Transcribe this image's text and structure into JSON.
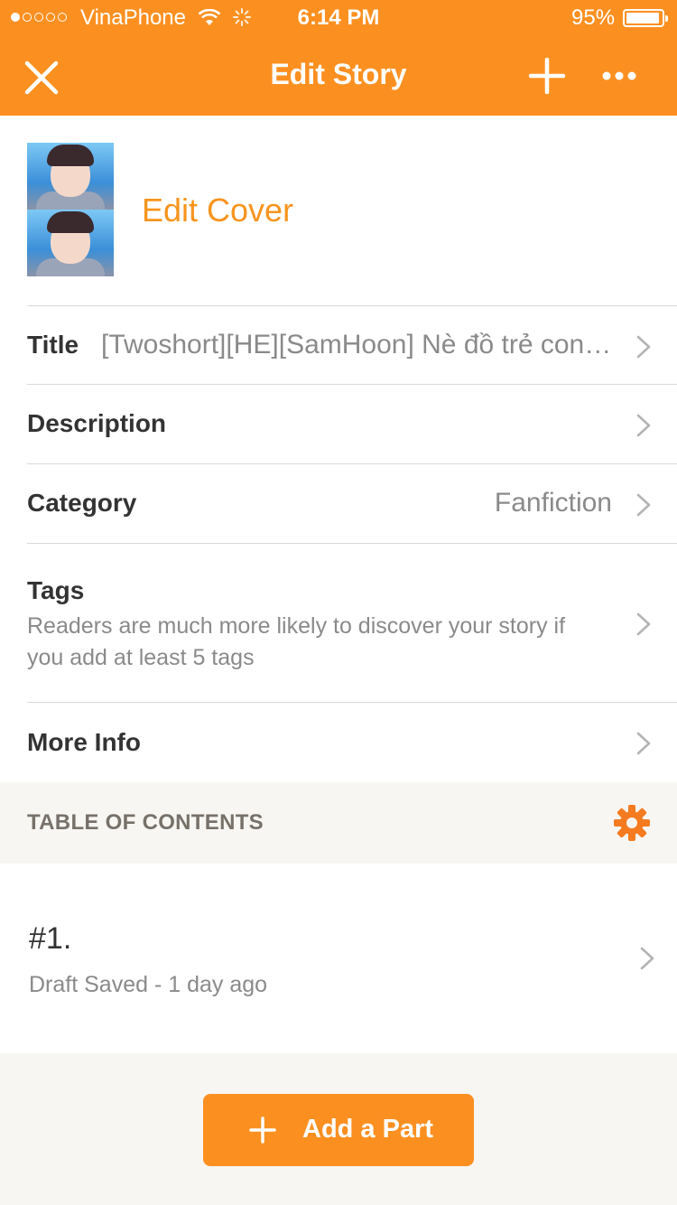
{
  "status_bar": {
    "carrier": "VinaPhone",
    "time": "6:14 PM",
    "battery_percent": "95%",
    "battery_level": 0.95,
    "signal_bars_filled": 1,
    "signal_bars_total": 5
  },
  "nav": {
    "title": "Edit Story",
    "close_icon": "close-icon",
    "add_icon": "plus-icon",
    "more_icon": "more-icon"
  },
  "cover": {
    "edit_label": "Edit Cover"
  },
  "fields": {
    "title": {
      "label": "Title",
      "value": "[Twoshort][HE][SamHoon] Nè đồ trẻ con! Đứng lại đó!"
    },
    "description": {
      "label": "Description"
    },
    "category": {
      "label": "Category",
      "value": "Fanfiction"
    },
    "tags": {
      "label": "Tags",
      "hint": "Readers are much more likely to discover your story if you add at least 5 tags"
    },
    "more_info": {
      "label": "More Info"
    }
  },
  "toc": {
    "title": "TABLE OF CONTENTS",
    "settings_icon": "gear-icon"
  },
  "parts": [
    {
      "number": "#1.",
      "status": "Draft Saved - 1 day ago"
    }
  ],
  "add_part": {
    "label": "Add a Part"
  },
  "colors": {
    "accent": "#fb9021",
    "edit_cover_text": "#f7941e",
    "gear": "#f47b20"
  }
}
